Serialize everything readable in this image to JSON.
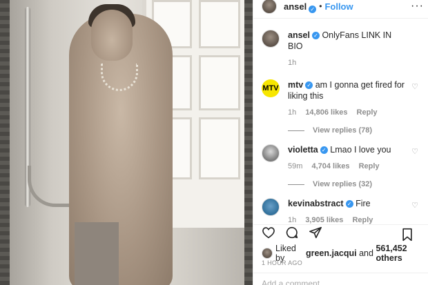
{
  "header": {
    "username": "ansel",
    "separator": "•",
    "follow_label": "Follow",
    "more_icon": "more-dots-icon"
  },
  "caption": {
    "username": "ansel",
    "text": "OnlyFans LINK IN BIO",
    "time": "1h"
  },
  "comments": [
    {
      "username": "mtv",
      "text": "am I gonna get fired for liking this",
      "time": "1h",
      "likes": "14,806 likes",
      "reply_label": "Reply",
      "view_replies": "View replies (78)"
    },
    {
      "username": "violetta",
      "text": "Lmao I love you",
      "time": "59m",
      "likes": "4,704 likes",
      "reply_label": "Reply",
      "view_replies": "View replies (32)"
    },
    {
      "username": "kevinabstract",
      "text": "Fire",
      "time": "1h",
      "likes": "3,905 likes",
      "reply_label": "Reply"
    }
  ],
  "actions": {
    "like_icon": "heart-icon",
    "comment_icon": "comment-icon",
    "share_icon": "share-icon",
    "save_icon": "bookmark-icon"
  },
  "likes_summary": {
    "prefix": "Liked by",
    "user": "green.jacqui",
    "conjunction": "and",
    "count": "561,452 others"
  },
  "timestamp": "1 HOUR AGO",
  "add_comment_placeholder": "Add a comment...",
  "mtv_logo_text": "MTV"
}
